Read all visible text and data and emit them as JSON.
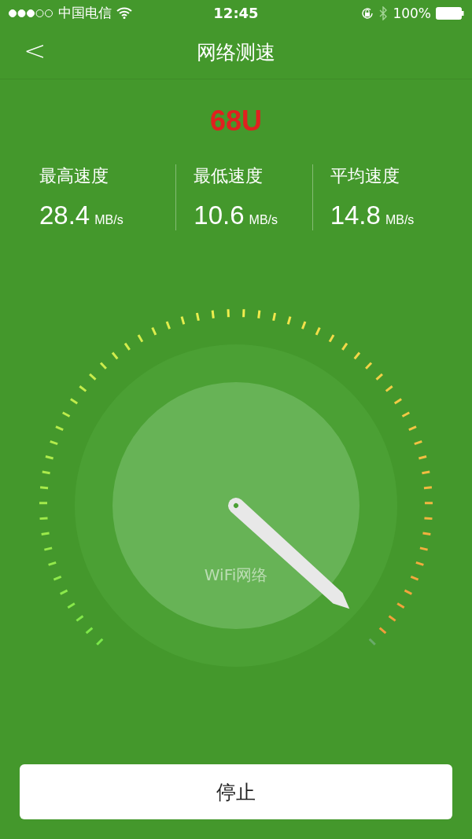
{
  "status_bar": {
    "carrier": "中国电信",
    "time": "12:45",
    "battery": "100%"
  },
  "nav": {
    "back": "<",
    "title": "网络测速"
  },
  "score": "68U",
  "stats": [
    {
      "label": "最高速度",
      "value": "28.4",
      "unit": "MB/s"
    },
    {
      "label": "最低速度",
      "value": "10.6",
      "unit": "MB/s"
    },
    {
      "label": "平均速度",
      "value": "14.8",
      "unit": "MB/s"
    }
  ],
  "gauge": {
    "label": "WiFi网络"
  },
  "button": "停止"
}
